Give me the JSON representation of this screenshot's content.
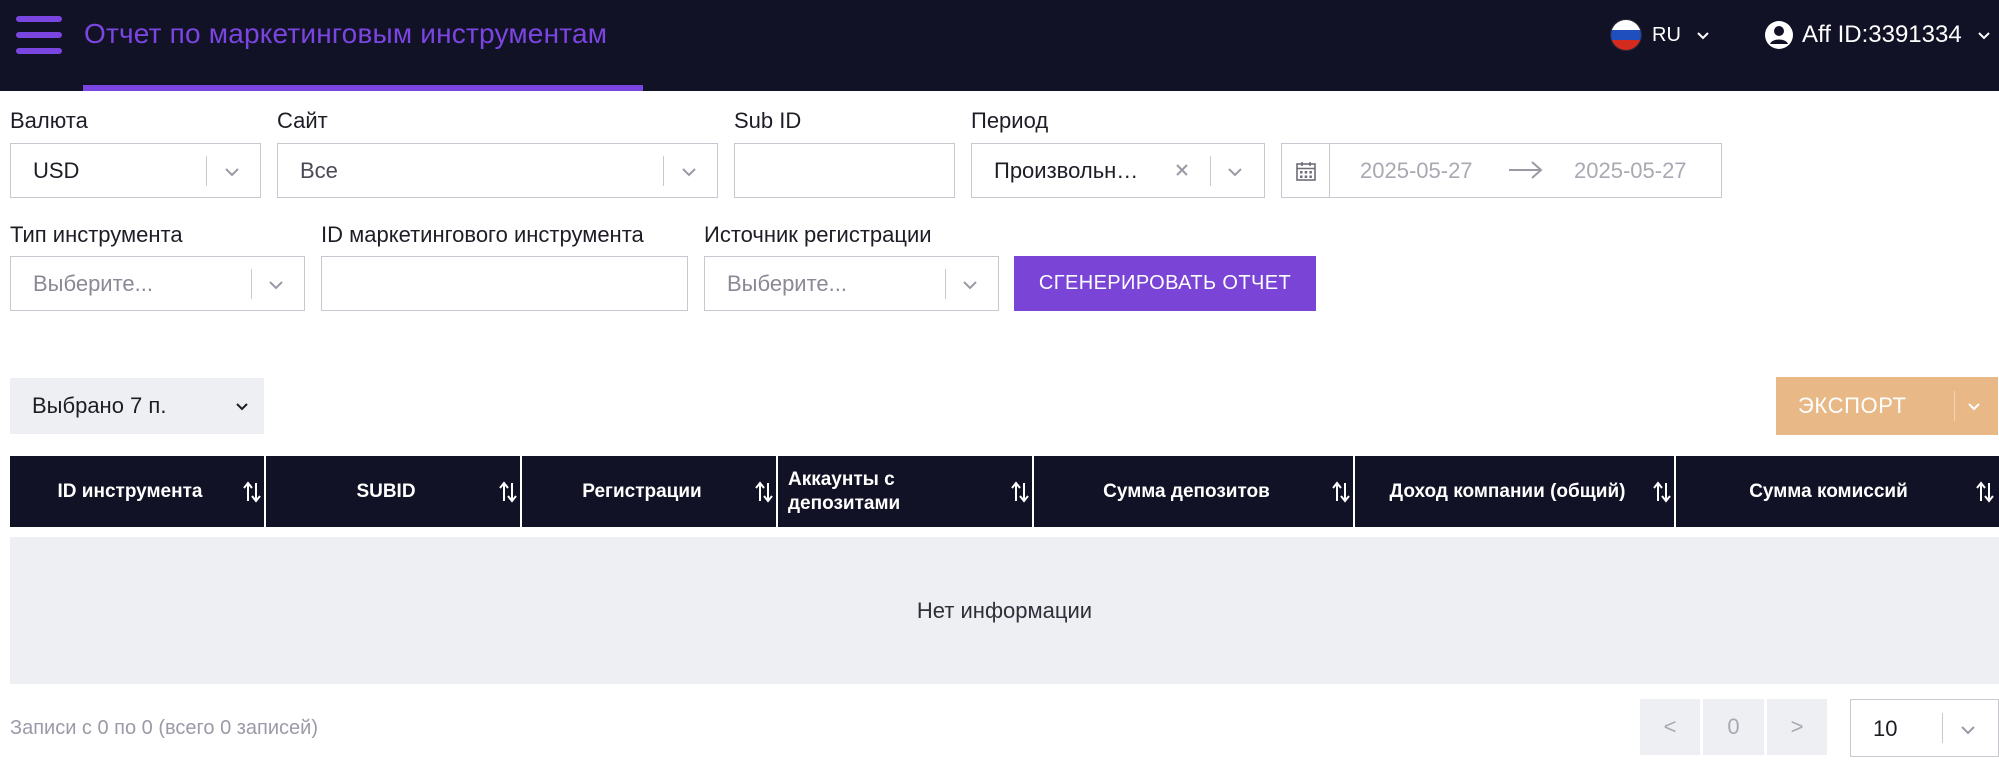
{
  "header": {
    "title": "Отчет по маркетинговым инструментам",
    "language": "RU",
    "account": "Aff ID:3391334"
  },
  "filters": {
    "currency": {
      "label": "Валюта",
      "value": "USD"
    },
    "site": {
      "label": "Сайт",
      "value": "Все"
    },
    "sub_id": {
      "label": "Sub ID",
      "value": ""
    },
    "period": {
      "label": "Период",
      "value": "Произвольн…"
    },
    "date_from": "2025-05-27",
    "date_to": "2025-05-27",
    "tool_type": {
      "label": "Тип инструмента",
      "placeholder": "Выберите..."
    },
    "tool_id": {
      "label": "ID маркетингового инструмента",
      "value": ""
    },
    "reg_source": {
      "label": "Источник регистрации",
      "placeholder": "Выберите..."
    },
    "generate_label": "СГЕНЕРИРОВАТЬ ОТЧЕТ"
  },
  "toolbar": {
    "columns_selected": "Выбрано 7 п.",
    "export_label": "ЭКСПОРТ"
  },
  "table": {
    "columns": [
      "ID инструмента",
      "SUBID",
      "Регистрации",
      "Аккаунты с депозитами",
      "Сумма депозитов",
      "Доход компании (общий)",
      "Сумма комиссий"
    ],
    "empty_text": "Нет информации"
  },
  "footer": {
    "records_text": "Записи с 0 по 0 (всего 0 записей)",
    "prev": "<",
    "page": "0",
    "next": ">",
    "page_size": "10"
  },
  "colors": {
    "accent": "#7a45e0",
    "header_bg": "#121226",
    "export_bg": "#e8b987",
    "muted_bg": "#eeeff3"
  }
}
